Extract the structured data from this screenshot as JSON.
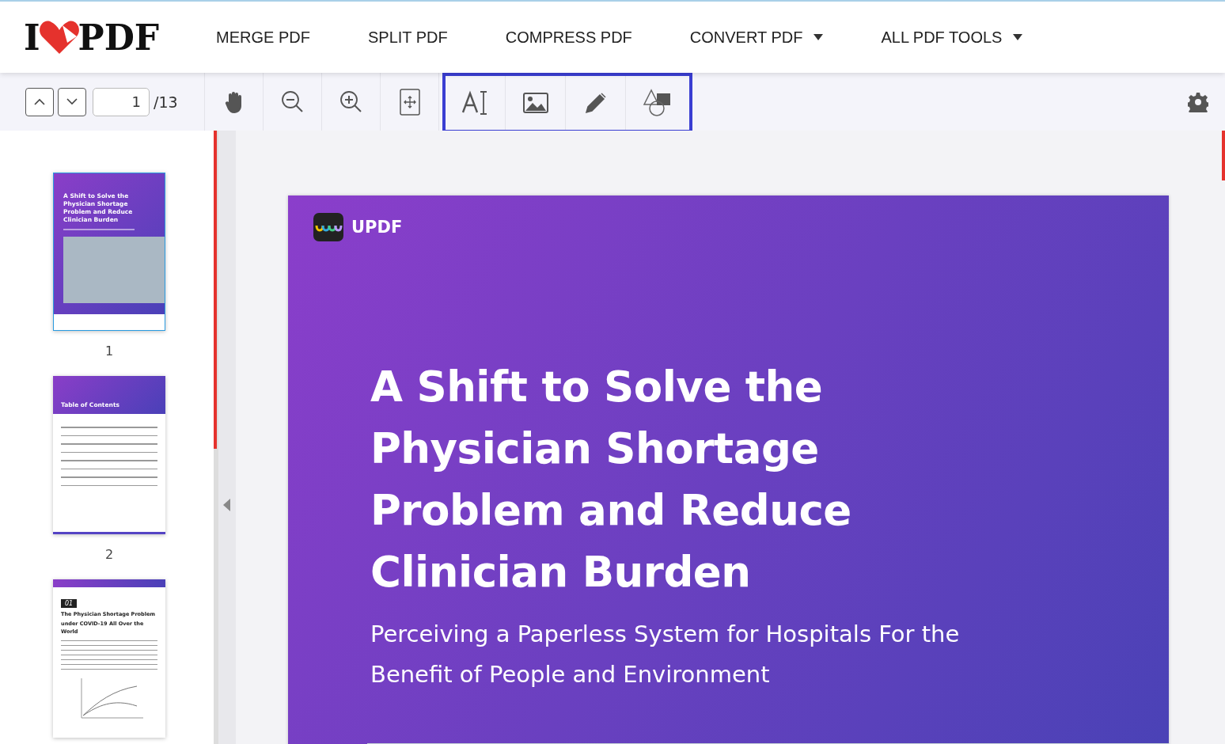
{
  "header": {
    "logo": {
      "left": "I",
      "right": "PDF"
    },
    "nav": [
      {
        "label": "MERGE PDF",
        "dropdown": false
      },
      {
        "label": "SPLIT PDF",
        "dropdown": false
      },
      {
        "label": "COMPRESS PDF",
        "dropdown": false
      },
      {
        "label": "CONVERT PDF",
        "dropdown": true
      },
      {
        "label": "ALL PDF TOOLS",
        "dropdown": true
      }
    ]
  },
  "toolbar": {
    "page": "1",
    "total": "/13"
  },
  "thumbnails": [
    {
      "kind": "cover",
      "number": "1",
      "lines": [
        "A Shift to Solve the",
        "Physician Shortage",
        "Problem and Reduce",
        "Clinician Burden"
      ]
    },
    {
      "kind": "contents",
      "number": "2",
      "lines": [
        "Table of Contents"
      ]
    },
    {
      "kind": "chapter",
      "badge": "01",
      "lines": [
        "The Physician Shortage Problem",
        "under COVID-19 All Over the World"
      ]
    }
  ],
  "page": {
    "brand": "UPDF",
    "title": [
      "A Shift to Solve the",
      "Physician Shortage",
      "Problem and Reduce",
      "Clinician Burden"
    ],
    "subtitle": [
      "Perceiving a Paperless System for Hospitals For the",
      "Benefit of People and Environment"
    ]
  }
}
